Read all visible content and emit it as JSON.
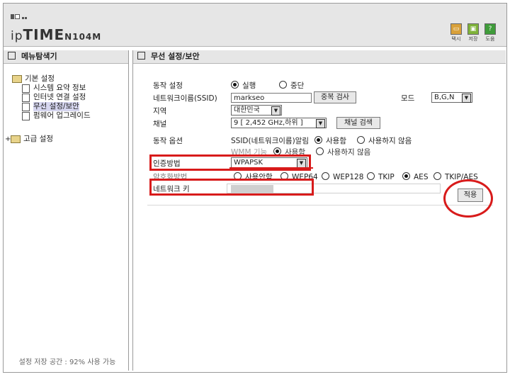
{
  "header": {
    "brand_prefix": "ip",
    "brand_bold": "TIME",
    "model": "N104M",
    "buttons": [
      {
        "label": "택시",
        "icon": "minimize-icon",
        "color": "#d9a13a"
      },
      {
        "label": "저장",
        "icon": "save-icon",
        "color": "#7fb33a"
      },
      {
        "label": "도움",
        "icon": "help-icon",
        "glyph": "?",
        "color": "#3f9c3a"
      }
    ]
  },
  "sidebar": {
    "title": "메뉴탐색기",
    "groups": [
      {
        "label": "기본 설정",
        "items": [
          {
            "label": "시스템 요약 정보"
          },
          {
            "label": "인터넷 연결 설정"
          },
          {
            "label": "무선 설정/보안",
            "selected": true
          },
          {
            "label": "펌웨어 업그레이드"
          }
        ]
      },
      {
        "label": "고급 설정",
        "expander": "+"
      }
    ],
    "storage_status": "설정 저장 공간 : 92% 사용 가능"
  },
  "main": {
    "title": "무선 설정/보안",
    "fields": {
      "operation": {
        "label": "동작 설정",
        "options": [
          "실행",
          "중단"
        ],
        "selected": "실행"
      },
      "ssid": {
        "label": "네트워크이름(SSID)",
        "value": "markseo",
        "check_button": "중복 검사",
        "mode_label": "모드",
        "mode_value": "B,G,N"
      },
      "region": {
        "label": "지역",
        "value": "대한민국"
      },
      "channel": {
        "label": "채널",
        "value": "9 [ 2,452 GHz,하위 ]",
        "search_button": "채널 검색"
      },
      "options": {
        "label": "동작 옵션",
        "ssid_broadcast_label": "SSID(네트워크이름)알림",
        "ssid_broadcast_options": [
          "사용함",
          "사용하지 않음"
        ],
        "ssid_broadcast_selected": "사용함",
        "wmm_label": "WMM 기능",
        "wmm_options": [
          "사용함",
          "사용하지 않음"
        ],
        "wmm_selected": "사용함"
      },
      "auth": {
        "label": "인증방법",
        "value": "WPAPSK"
      },
      "encryption": {
        "label": "암호화방법",
        "options": [
          "사용안함",
          "WEP64",
          "WEP128",
          "TKIP",
          "AES",
          "TKIP/AES"
        ],
        "selected": "AES"
      },
      "network_key": {
        "label": "네트워크 키"
      }
    },
    "apply_button": "적용",
    "annotation_color": "#d81b1b"
  }
}
